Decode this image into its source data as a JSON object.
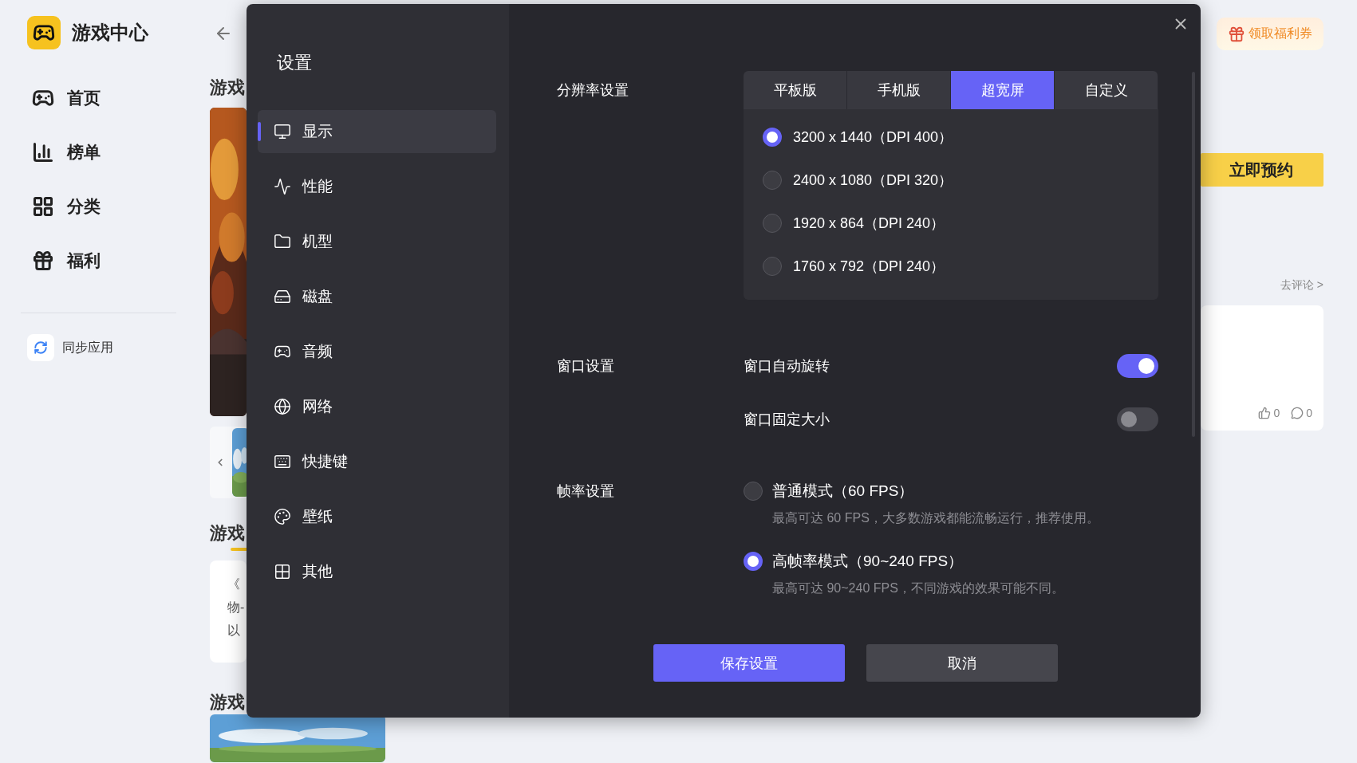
{
  "app": {
    "title": "游戏中心"
  },
  "sidebar": {
    "items": [
      {
        "label": "首页"
      },
      {
        "label": "榜单"
      },
      {
        "label": "分类"
      },
      {
        "label": "福利"
      }
    ],
    "sync_label": "同步应用"
  },
  "background": {
    "headings": [
      "游戏",
      "游戏",
      "游戏"
    ],
    "card_lines": [
      "《",
      "物-",
      "以"
    ],
    "coupon": "领取福利券",
    "reserve": "立即预约",
    "comment_link": "去评论 >",
    "likes": "0",
    "comments": "0"
  },
  "dialog": {
    "title": "设置",
    "nav": [
      {
        "label": "显示",
        "selected": true
      },
      {
        "label": "性能",
        "selected": false
      },
      {
        "label": "机型",
        "selected": false
      },
      {
        "label": "磁盘",
        "selected": false
      },
      {
        "label": "音频",
        "selected": false
      },
      {
        "label": "网络",
        "selected": false
      },
      {
        "label": "快捷键",
        "selected": false
      },
      {
        "label": "壁纸",
        "selected": false
      },
      {
        "label": "其他",
        "selected": false
      }
    ],
    "resolution": {
      "label": "分辨率设置",
      "tabs": [
        {
          "label": "平板版",
          "selected": false
        },
        {
          "label": "手机版",
          "selected": false
        },
        {
          "label": "超宽屏",
          "selected": true
        },
        {
          "label": "自定义",
          "selected": false
        }
      ],
      "options": [
        {
          "label": "3200 x 1440（DPI 400）",
          "selected": true
        },
        {
          "label": "2400 x 1080（DPI 320）",
          "selected": false
        },
        {
          "label": "1920 x 864（DPI 240）",
          "selected": false
        },
        {
          "label": "1760 x 792（DPI 240）",
          "selected": false
        }
      ]
    },
    "window": {
      "label": "窗口设置",
      "toggles": [
        {
          "label": "窗口自动旋转",
          "on": true
        },
        {
          "label": "窗口固定大小",
          "on": false
        }
      ]
    },
    "fps": {
      "label": "帧率设置",
      "options": [
        {
          "label": "普通模式（60 FPS）",
          "hint": "最高可达 60 FPS，大多数游戏都能流畅运行，推荐使用。",
          "selected": false
        },
        {
          "label": "高帧率模式（90~240 FPS）",
          "hint": "最高可达 90~240 FPS，不同游戏的效果可能不同。",
          "selected": true
        }
      ]
    },
    "buttons": [
      {
        "label": "保存设置",
        "kind": "primary"
      },
      {
        "label": "取消",
        "kind": "secondary"
      }
    ]
  }
}
